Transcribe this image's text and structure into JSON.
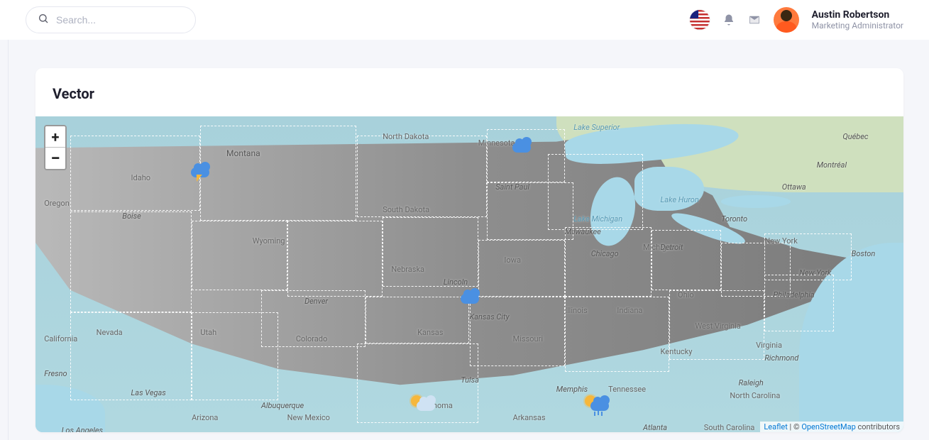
{
  "search": {
    "placeholder": "Search..."
  },
  "user": {
    "name": "Austin Robertson",
    "role": "Marketing Administrator"
  },
  "card": {
    "title": "Vector"
  },
  "map": {
    "zoom_in": "+",
    "zoom_out": "−",
    "attribution": {
      "leaflet": "Leaflet",
      "sep": " | © ",
      "osm": "OpenStreetMap",
      "tail": " contributors"
    },
    "labels": {
      "montana": "Montana",
      "ndak": "North Dakota",
      "sdak": "South Dakota",
      "minnesota": "Minnesota",
      "wyoming": "Wyoming",
      "idaho": "Idaho",
      "oregon": "Oregon",
      "nevada": "Nevada",
      "california": "California",
      "utah": "Utah",
      "colorado": "Colorado",
      "arizona": "Arizona",
      "nmex": "New Mexico",
      "nebraska": "Nebraska",
      "kansas": "Kansas",
      "oklahoma": "Oklahoma",
      "iowa": "Iowa",
      "missouri": "Missouri",
      "arkansas": "Arkansas",
      "illinois": "Illinois",
      "indiana": "Indiana",
      "ohio": "Ohio",
      "kentucky": "Kentucky",
      "tennessee": "Tennessee",
      "wva": "West Virginia",
      "scar": "South Carolina",
      "ncar": "North Carolina",
      "virginia": "Virginia",
      "michigan": "Michigan",
      "newyork": "New York",
      "boise": "Boise",
      "denver": "Denver",
      "lincoln": "Lincoln",
      "kc": "Kansas City",
      "tulsa": "Tulsa",
      "fresno": "Fresno",
      "stpaul": "Saint Paul",
      "milwaukee": "Milwaukee",
      "chicago": "Chicago",
      "detroit": "Detroit",
      "toronto": "Toronto",
      "ottawa": "Ottawa",
      "montreal": "Montréal",
      "quebec": "Québec",
      "memphis": "Memphis",
      "atlanta": "Atlanta",
      "raleigh": "Raleigh",
      "richmond": "Richmond",
      "phila": "Philadelphia",
      "newyorkc": "New York",
      "boston": "Boston",
      "abq": "Albuquerque",
      "la": "Los Angeles",
      "lv": "Las Vegas",
      "superior": "Lake Superior",
      "michiganl": "Lake Michigan",
      "huron": "Lake Huron"
    }
  }
}
